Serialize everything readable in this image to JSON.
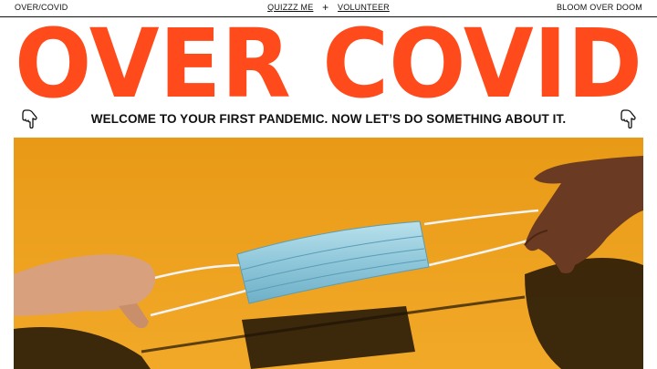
{
  "nav": {
    "brand": "OVER/COVID",
    "links": [
      {
        "label": "QUIZZZ ME"
      },
      {
        "label": "VOLUNTEER"
      }
    ],
    "separator": "+",
    "right_label": "BLOOM OVER DOOM"
  },
  "hero": {
    "title": "OVER COVID",
    "color": "#ff4a1c"
  },
  "tagline": "WELCOME TO YOUR FIRST PANDEMIC. NOW LET’S DO SOMETHING ABOUT IT.",
  "icons": [
    "pointing-hand-icon",
    "pointing-hand-icon"
  ],
  "photo": {
    "background_color": "#f0a51f",
    "subject": "surgical-mask"
  }
}
